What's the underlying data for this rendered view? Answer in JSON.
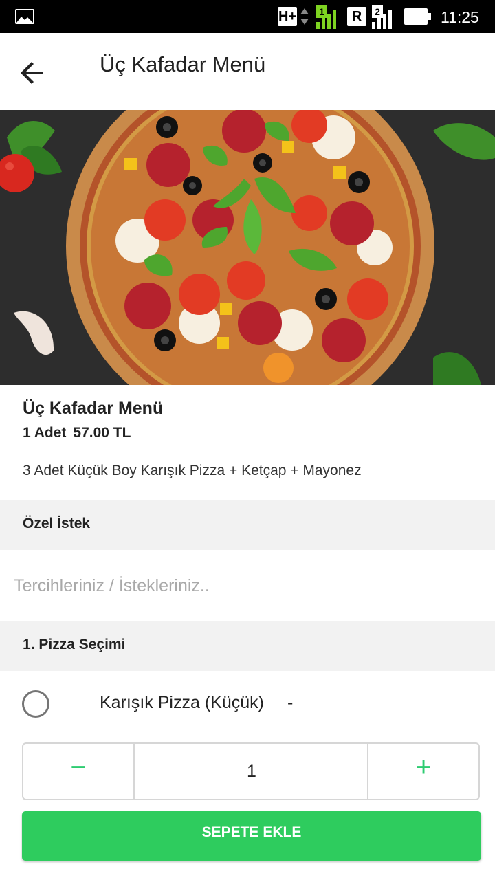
{
  "status_bar": {
    "network": "H+",
    "sim1": "1",
    "roaming": "R",
    "sim2": "2",
    "time": "11:25"
  },
  "appbar": {
    "title": "Üç Kafadar Menü",
    "back_icon": "arrow-left-icon"
  },
  "product": {
    "name": "Üç Kafadar Menü",
    "quantity": "1 Adet",
    "price": "57.00 TL",
    "description": "3 Adet Küçük Boy Karışık Pizza + Ketçap + Mayonez"
  },
  "special_request": {
    "title": "Özel İstek",
    "placeholder": "Tercihleriniz / İstekleriniz.."
  },
  "pizza_selection": {
    "title": "1. Pizza Seçimi",
    "option_label": "Karışık Pizza (Küçük)",
    "option_price": "-"
  },
  "stepper": {
    "minus": "−",
    "value": "1",
    "plus": "+"
  },
  "add_to_cart": "SEPETE EKLE",
  "colors": {
    "accent": "#2ecc5e",
    "section_bg": "#f2f2f2"
  }
}
